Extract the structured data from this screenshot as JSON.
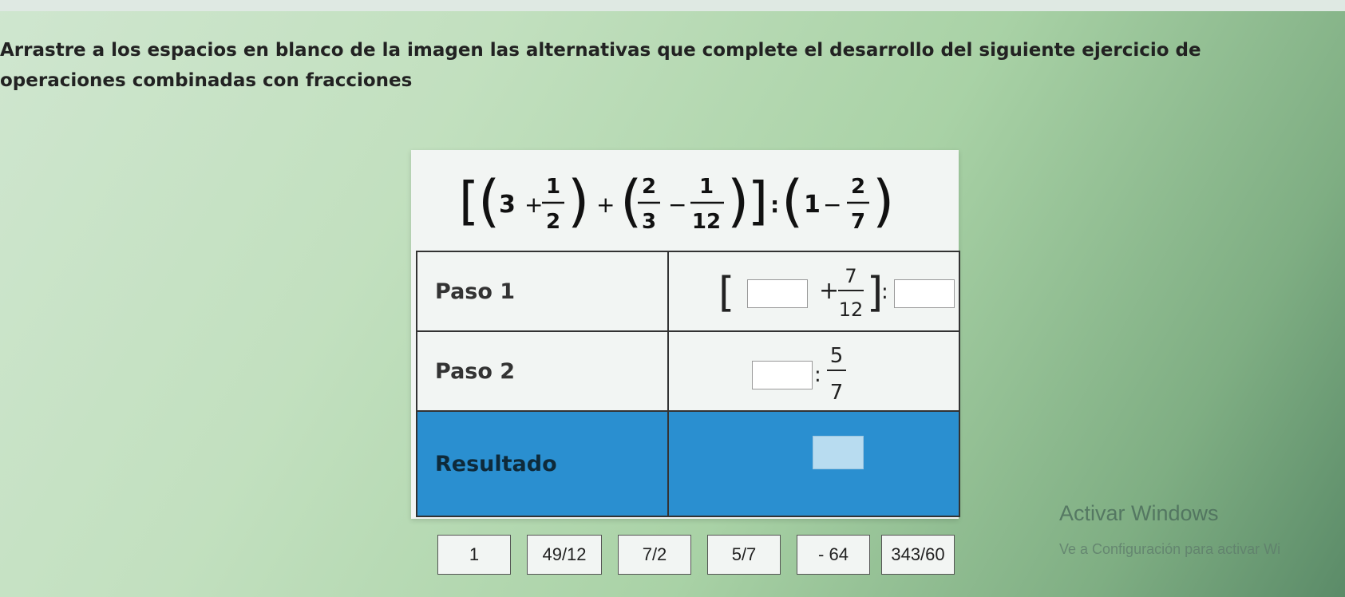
{
  "instruction": "Arrastre a los espacios en blanco de la imagen las alternativas que complete el desarrollo del siguiente ejercicio de operaciones combinadas con fracciones",
  "expression": {
    "n1": "3",
    "plus1": "+",
    "f1_num": "1",
    "f1_den": "2",
    "plus2": "+",
    "f2_num": "2",
    "f2_den": "3",
    "minus1": "−",
    "f3_num": "1",
    "f3_den": "12",
    "colon": ":",
    "n2": "1",
    "minus2": "−",
    "f4_num": "2",
    "f4_den": "7"
  },
  "steps": [
    {
      "label": "Paso 1",
      "plus": "+",
      "frac_num": "7",
      "frac_den": "12",
      "colon": ":"
    },
    {
      "label": "Paso 2",
      "colon": ":",
      "frac_num": "5",
      "frac_den": "7"
    },
    {
      "label": "Resultado"
    }
  ],
  "options": [
    "1",
    "49/12",
    "7/2",
    "5/7",
    "- 64",
    "343/60"
  ],
  "watermark": {
    "title": "Activar Windows",
    "subtitle": "Ve a Configuración para activar Wi"
  },
  "colors": {
    "result_row": "#2a8fd0",
    "drop_slot": "#b8dcf0"
  }
}
